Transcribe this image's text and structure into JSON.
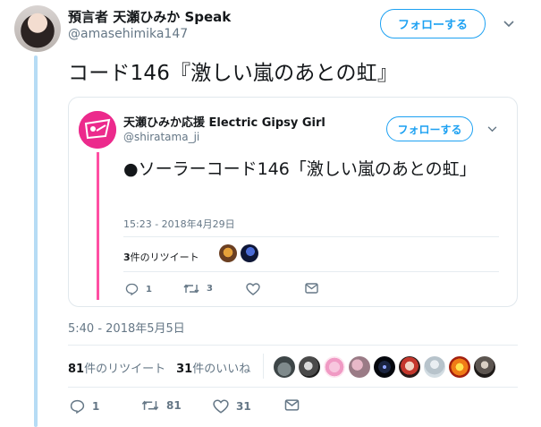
{
  "tweet": {
    "author_name": "預言者 天瀬ひみか Speak",
    "author_handle": "@amasehimika147",
    "follow_label": "フォローする",
    "text": "コード146『激しい嵐のあとの虹』",
    "timestamp": "5:40 - 2018年5月5日",
    "retweet_count": "81",
    "retweet_label": "件のリツイート",
    "like_count": "31",
    "like_label": "件のいいね",
    "actions": {
      "reply": "1",
      "retweet": "81",
      "like": "31"
    }
  },
  "quoted": {
    "author_name": "天瀬ひみか応援 Electric Gipsy Girl",
    "author_handle": "@shiratama_ji",
    "follow_label": "フォローする",
    "text": "●ソーラーコード146「激しい嵐のあとの虹」",
    "timestamp": "15:23 - 2018年4月29日",
    "retweet_count": "3",
    "retweet_label": "件のリツイート",
    "actions": {
      "reply": "1",
      "retweet": "3"
    }
  },
  "icons": [
    "chevron-down-icon",
    "reply-icon",
    "retweet-icon",
    "like-icon",
    "message-icon"
  ],
  "colors": {
    "accent": "#1da1f2",
    "thread_line": "#b6dcf5",
    "quote_thread": "#ff4fa3",
    "muted": "#657786"
  }
}
